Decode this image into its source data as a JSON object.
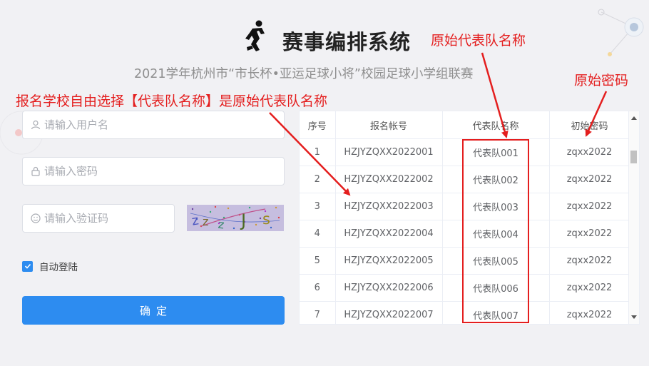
{
  "header": {
    "title": "赛事编排系统",
    "subtitle": "2021学年杭州市“市长杯•亚运足球小将”校园足球小学组联赛"
  },
  "login_form": {
    "username_placeholder": "请输入用户名",
    "password_placeholder": "请输入密码",
    "captcha_placeholder": "请输入验证码",
    "captcha_text": [
      "z",
      "z",
      "z",
      "J",
      "s"
    ],
    "remember_label": "自动登陆",
    "remember_checked": true,
    "submit_label": "确定"
  },
  "table": {
    "columns": [
      "序号",
      "报名帐号",
      "代表队名称",
      "初始密码"
    ],
    "rows": [
      [
        "1",
        "HZJYZQXX2022001",
        "代表队001",
        "zqxx2022"
      ],
      [
        "2",
        "HZJYZQXX2022002",
        "代表队002",
        "zqxx2022"
      ],
      [
        "3",
        "HZJYZQXX2022003",
        "代表队003",
        "zqxx2022"
      ],
      [
        "4",
        "HZJYZQXX2022004",
        "代表队004",
        "zqxx2022"
      ],
      [
        "5",
        "HZJYZQXX2022005",
        "代表队005",
        "zqxx2022"
      ],
      [
        "6",
        "HZJYZQXX2022006",
        "代表队006",
        "zqxx2022"
      ],
      [
        "7",
        "HZJYZQXX2022007",
        "代表队007",
        "zqxx2022"
      ]
    ]
  },
  "annotations": {
    "team_name": "原始代表队名称",
    "password": "原始密码",
    "note": "报名学校自由选择【代表队名称】是原始代表队名称"
  },
  "colors": {
    "accent": "#2d8cf0",
    "annotation_red": "#e41e1e"
  },
  "icons": {
    "logo": "runner-icon",
    "username": "user-icon",
    "password": "lock-icon",
    "captcha": "smile-icon",
    "checkbox": "check-icon"
  }
}
